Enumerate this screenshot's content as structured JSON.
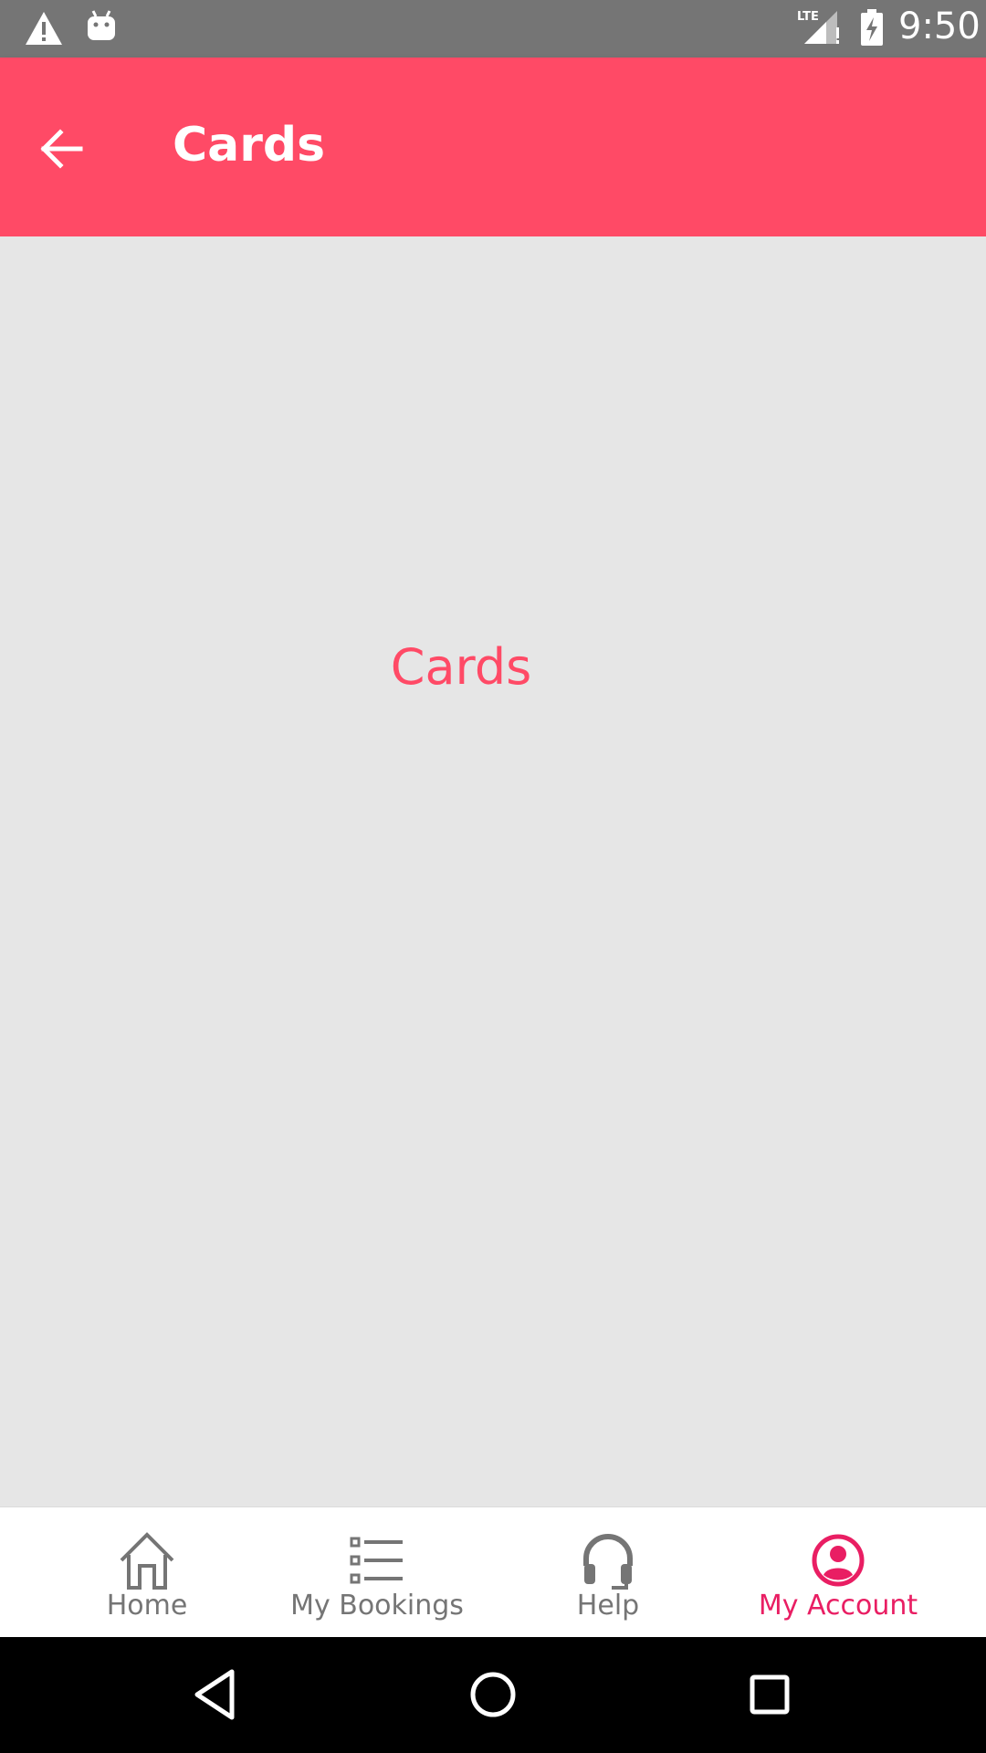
{
  "status_bar": {
    "time": "9:50",
    "icons": [
      "warning-icon",
      "android-icon",
      "lte-signal-icon",
      "battery-charging-icon"
    ]
  },
  "app_bar": {
    "title": "Cards",
    "back_icon": "arrow-left-icon"
  },
  "content": {
    "text": "Cards"
  },
  "bottom_nav": {
    "items": [
      {
        "label": "Home",
        "icon": "home-icon",
        "active": false
      },
      {
        "label": "My Bookings",
        "icon": "list-icon",
        "active": false
      },
      {
        "label": "Help",
        "icon": "headset-icon",
        "active": false
      },
      {
        "label": "My Account",
        "icon": "account-circle-icon",
        "active": true
      }
    ]
  },
  "system_nav": {
    "icons": [
      "back-triangle-icon",
      "home-circle-icon",
      "recents-square-icon"
    ]
  },
  "colors": {
    "status_bar": "#757575",
    "primary": "#ff4a66",
    "active_nav": "#e91e63",
    "inactive_nav": "#757575",
    "content_bg": "#e6e6e6",
    "system_nav": "#000000"
  }
}
